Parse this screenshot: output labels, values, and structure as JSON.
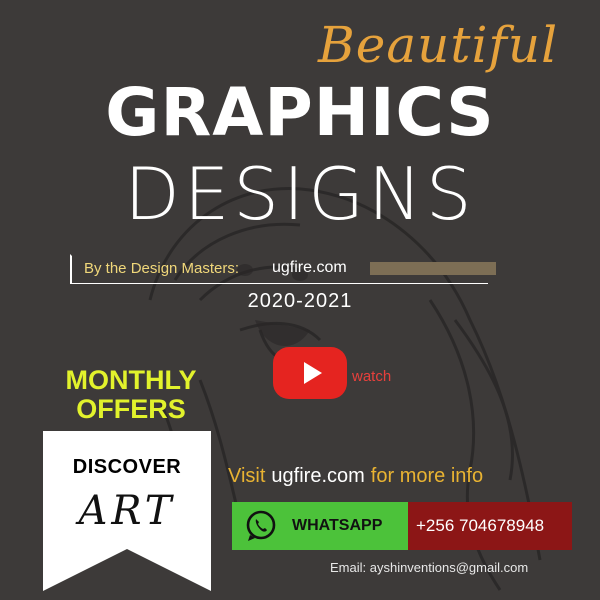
{
  "headline": {
    "script_word": "Beautiful",
    "word1": "GRAPHICS",
    "word2": "DESIGNS"
  },
  "byline": {
    "text": "By the Design Masters:",
    "site": "ugfire.com",
    "years": "2020-2021"
  },
  "video": {
    "watch_label": "watch",
    "icon": "youtube-play-icon",
    "color": "#e52420"
  },
  "offers": {
    "line1": "MONTHLY",
    "line2": "OFFERS",
    "color": "#e2f22c"
  },
  "ribbon": {
    "line1": "DISCOVER",
    "line2": "ART"
  },
  "visit": {
    "prefix": "Visit",
    "site": "ugfire.com",
    "suffix": "for more info"
  },
  "contact": {
    "whatsapp_label": "WHATSAPP",
    "whatsapp_icon": "whatsapp-icon",
    "phone": "+256 704678948",
    "email": "Email: ayshinventions@gmail.com"
  },
  "colors": {
    "background": "#3d3a39",
    "accent_gold": "#e6a23c",
    "whatsapp_green": "#4cc23a",
    "phone_red": "#8c1616"
  }
}
